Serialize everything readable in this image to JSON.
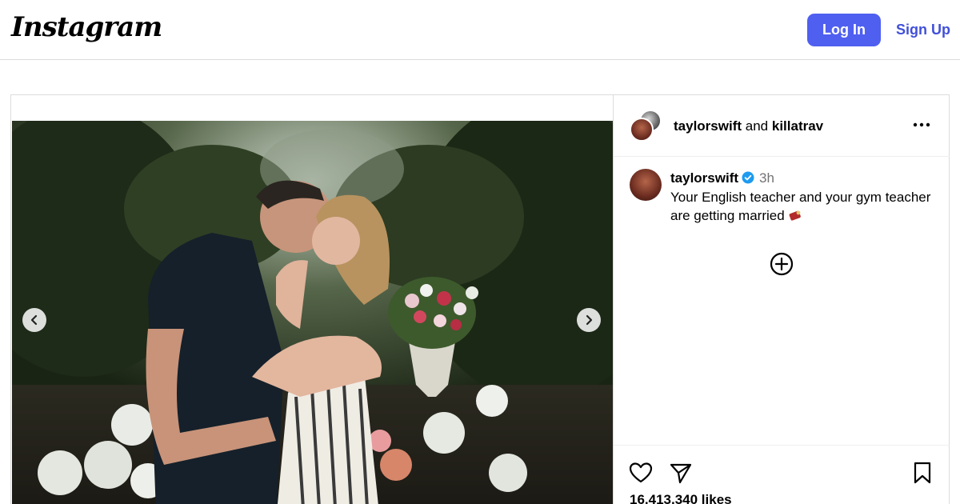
{
  "header": {
    "logo_text": "Instagram",
    "login_label": "Log In",
    "signup_label": "Sign Up"
  },
  "post": {
    "author_primary": "taylorswift",
    "author_connector": "and",
    "author_secondary": "killatrav",
    "caption": {
      "username": "taylorswift",
      "time": "3h",
      "text": "Your English teacher and your gym teacher are getting married"
    },
    "likes": "16,413,340 likes",
    "icons": [
      "more-options-icon",
      "verified-badge-icon",
      "ring-emoji-icon",
      "add-circle-icon",
      "heart-icon",
      "share-icon",
      "bookmark-icon",
      "chevron-left-icon",
      "chevron-right-icon"
    ]
  },
  "colors": {
    "brand_button": "#4f5ff0",
    "link": "#4150d9",
    "verified": "#1d9bf0",
    "border": "#dbdbdb",
    "muted": "#737373"
  }
}
